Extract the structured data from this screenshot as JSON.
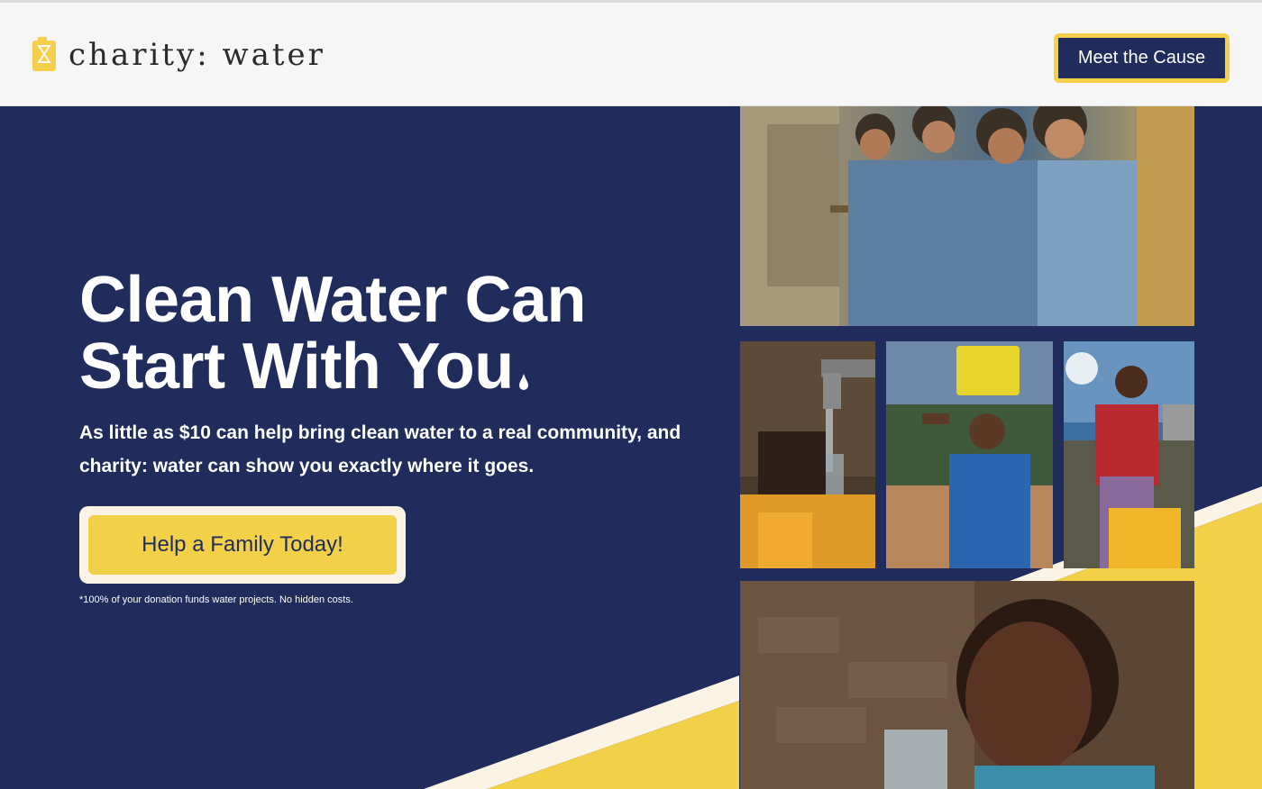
{
  "header": {
    "logo_text": "charity: water",
    "logo_icon": "jerrycan-icon",
    "cta_label": "Meet the Cause"
  },
  "hero": {
    "headline_line1": "Clean Water Can",
    "headline_line2": "Start With You",
    "subcopy": "As little as $10 can help bring clean water to a real community, and charity: water can show you exactly where it goes.",
    "donate_label": "Help a Family Today!",
    "footnote": "*100% of your donation funds water projects. No hidden costs."
  },
  "colors": {
    "navy": "#1f2c5c",
    "yellow": "#f2d048",
    "cream": "#fbf4e4",
    "header_bg": "#f6f6f6"
  }
}
